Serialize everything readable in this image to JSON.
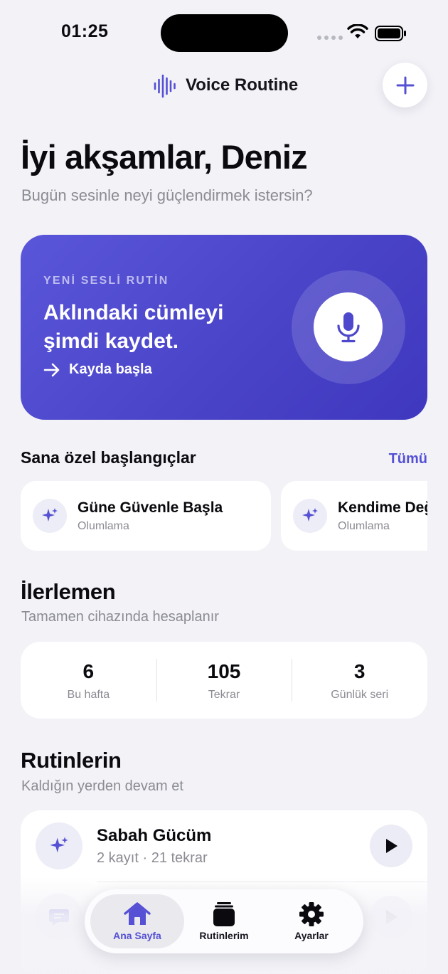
{
  "status_bar": {
    "time": "01:25"
  },
  "header": {
    "app_title": "Voice Routine",
    "add_icon": "plus-icon"
  },
  "greeting": {
    "title": "İyi akşamlar, Deniz",
    "subtitle": "Bugün sesinle neyi güçlendirmek istersin?"
  },
  "hero": {
    "eyebrow": "YENİ SESLİ RUTİN",
    "title": "Aklındaki cümleyi şimdi kaydet.",
    "cta": "Kayda başla",
    "icon": "microphone-icon"
  },
  "suggestions": {
    "title": "Sana özel başlangıçlar",
    "see_all": "Tümü",
    "items": [
      {
        "title": "Güne Güvenle Başla",
        "category": "Olumlama",
        "icon": "sparkle-icon"
      },
      {
        "title": "Kendime Değer",
        "category": "Olumlama",
        "icon": "sparkle-icon"
      }
    ]
  },
  "progress": {
    "title": "İlerlemen",
    "subtitle": "Tamamen cihazında hesaplanır",
    "stats": [
      {
        "value": "6",
        "label": "Bu hafta"
      },
      {
        "value": "105",
        "label": "Tekrar"
      },
      {
        "value": "3",
        "label": "Günlük seri"
      }
    ]
  },
  "routines": {
    "title": "Rutinlerin",
    "subtitle": "Kaldığın yerden devam et",
    "items": [
      {
        "title": "Sabah Gücüm",
        "meta": "2 kayıt · 21 tekrar",
        "icon": "sparkle-icon"
      }
    ]
  },
  "tabbar": {
    "items": [
      {
        "label": "Ana Sayfa",
        "icon": "home-icon",
        "active": true
      },
      {
        "label": "Rutinlerim",
        "icon": "stack-icon",
        "active": false
      },
      {
        "label": "Ayarlar",
        "icon": "gear-icon",
        "active": false
      }
    ]
  },
  "colors": {
    "accent": "#5550d4",
    "hero_start": "#5a56da",
    "hero_end": "#3f38bf",
    "background": "#f2f2f7"
  }
}
